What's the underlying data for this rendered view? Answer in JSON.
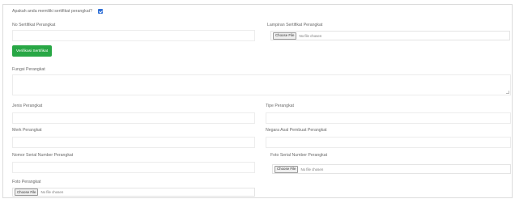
{
  "certificate_question": "Apakah anda memiliki sertifikat perangkat?",
  "certificate_checked": true,
  "fields": {
    "no_sertifikat": "No Sertifikat Perangkat",
    "lampiran_sertifikat": "Lampiran Sertifikat Perangkat",
    "fungsi": "Fungsi Perangkat",
    "jenis": "Jenis Perangkat",
    "tipe": "Tipe Perangkat",
    "merk": "Merk Perangkat",
    "negara_asal": "Negara Asal Pembuat Perangkat",
    "nomor_seri": "Nomor Serial Number Perangkat",
    "foto_nomor_seri": "Foto Serial Number Perangkat",
    "foto": "Foto Perangkat"
  },
  "verify_button": "Verifikasi Sertifikat",
  "file_input": {
    "choose_label": "Choose File",
    "no_file_label": "No file chosen"
  },
  "colors": {
    "button_green": "#28a745",
    "checkbox_blue": "#2f6fd6"
  }
}
